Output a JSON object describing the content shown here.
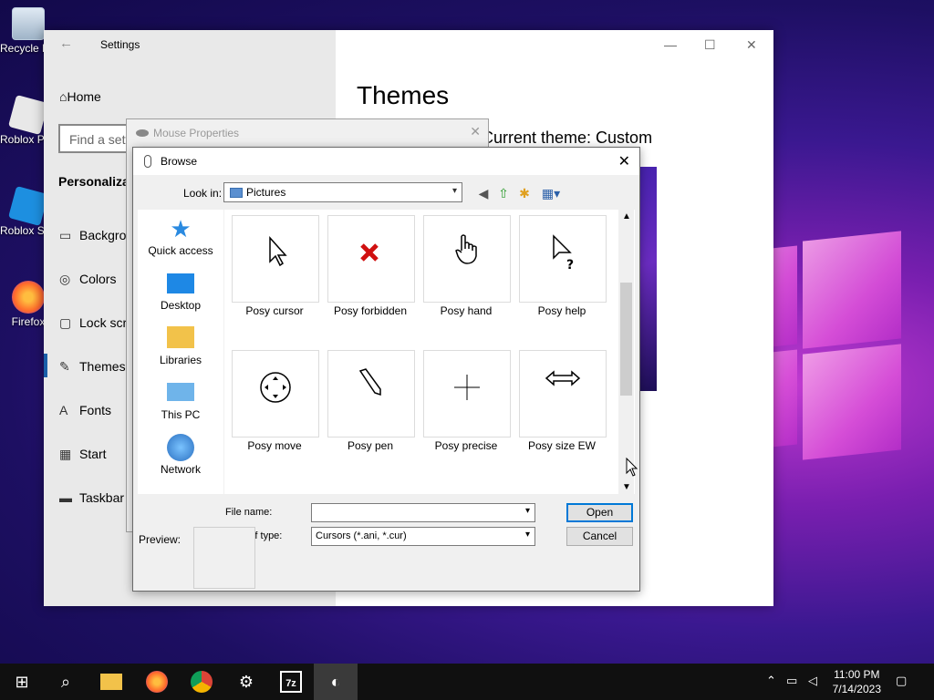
{
  "desktop": {
    "icons": [
      {
        "label": "Recycle Bin",
        "icon": "recycle-bin-icon"
      },
      {
        "label": "Roblox Player",
        "icon": "roblox-player-icon"
      },
      {
        "label": "Roblox Studio",
        "icon": "roblox-studio-icon"
      },
      {
        "label": "Firefox",
        "icon": "firefox-icon"
      }
    ]
  },
  "settings": {
    "title": "Settings",
    "home": "Home",
    "search_placeholder": "Find a setting",
    "section": "Personalization",
    "nav": [
      {
        "label": "Background",
        "icon": "picture-icon"
      },
      {
        "label": "Colors",
        "icon": "palette-icon"
      },
      {
        "label": "Lock screen",
        "icon": "monitor-icon"
      },
      {
        "label": "Themes",
        "icon": "brush-icon"
      },
      {
        "label": "Fonts",
        "icon": "font-icon"
      },
      {
        "label": "Start",
        "icon": "start-icon"
      },
      {
        "label": "Taskbar",
        "icon": "taskbar-icon"
      }
    ],
    "heading": "Themes",
    "subheading": "Current theme: Custom"
  },
  "mouse_properties": {
    "title": "Mouse Properties"
  },
  "browse": {
    "title": "Browse",
    "look_in_label": "Look in:",
    "look_in_value": "Pictures",
    "places": [
      {
        "label": "Quick access",
        "icon": "star-icon"
      },
      {
        "label": "Desktop",
        "icon": "desktop-icon"
      },
      {
        "label": "Libraries",
        "icon": "libraries-icon"
      },
      {
        "label": "This PC",
        "icon": "computer-icon"
      },
      {
        "label": "Network",
        "icon": "network-icon"
      }
    ],
    "files": [
      {
        "name": "Posy cursor",
        "icon": "arrow-cursor-icon"
      },
      {
        "name": "Posy forbidden",
        "icon": "forbidden-cursor-icon"
      },
      {
        "name": "Posy hand",
        "icon": "hand-cursor-icon"
      },
      {
        "name": "Posy help",
        "icon": "help-cursor-icon"
      },
      {
        "name": "Posy move",
        "icon": "move-cursor-icon"
      },
      {
        "name": "Posy pen",
        "icon": "pen-cursor-icon"
      },
      {
        "name": "Posy precise",
        "icon": "precise-cursor-icon"
      },
      {
        "name": "Posy size EW",
        "icon": "size-ew-cursor-icon"
      }
    ],
    "file_name_label": "File name:",
    "file_name_value": "",
    "files_of_type_label": "Files of type:",
    "files_of_type_value": "Cursors (*.ani, *.cur)",
    "open_label": "Open",
    "cancel_label": "Cancel",
    "preview_label": "Preview:"
  },
  "taskbar": {
    "time": "11:00 PM",
    "date": "7/14/2023",
    "apps": [
      "start-icon",
      "search-icon",
      "file-explorer-icon",
      "firefox-icon",
      "chrome-icon",
      "settings-gear-icon",
      "7zip-icon",
      "mouse-properties-icon"
    ]
  }
}
